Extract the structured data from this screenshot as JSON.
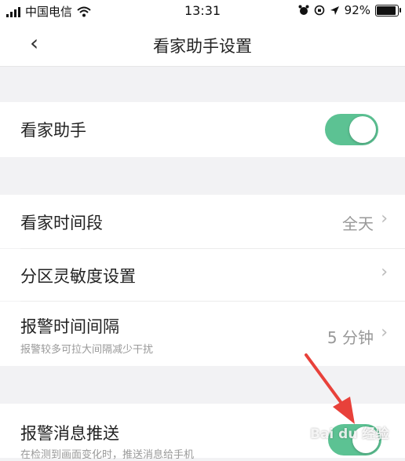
{
  "status_bar": {
    "carrier": "中国电信",
    "time": "13:31",
    "battery": "92%",
    "battery_level": 0.92,
    "icons": [
      "signal-icon",
      "wifi-icon",
      "alarm-icon",
      "lock-rotation-icon",
      "location-icon",
      "battery-icon"
    ]
  },
  "nav": {
    "back_glyph": "‹",
    "title": "看家助手设置"
  },
  "rows": {
    "assistant": {
      "label": "看家助手",
      "enabled": true
    },
    "period": {
      "label": "看家时间段",
      "value": "全天"
    },
    "sensitivity": {
      "label": "分区灵敏度设置"
    },
    "interval": {
      "label": "报警时间间隔",
      "sub": "报警较多可拉大间隔减少干扰",
      "value": "5 分钟"
    },
    "push": {
      "label": "报警消息推送",
      "sub": "在检测到画面变化时，推送消息给手机",
      "enabled": true
    }
  },
  "chevron": "›",
  "watermark": "Bai du 经验",
  "colors": {
    "toggle_on": "#5cc293",
    "arrow": "#e8413a",
    "background": "#f2f2f4"
  }
}
